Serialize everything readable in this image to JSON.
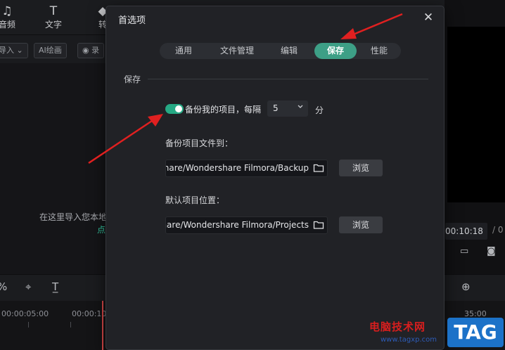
{
  "background": {
    "toolbar": [
      {
        "icon": "music-note-icon",
        "label": "音频"
      },
      {
        "icon": "text-icon",
        "label": "文字"
      },
      {
        "icon": "transition-icon",
        "label": "转"
      }
    ],
    "subbar": {
      "import_label": "导入",
      "ai_label": "AI绘画",
      "record_label": "录"
    },
    "media_hint": "在这里导入您本地",
    "media_link": "点",
    "timecode": "00:10:18",
    "timecode_sep": "/ 0",
    "ruler": [
      "00:00:05:00",
      "00:00:10"
    ],
    "ruler_right": "35:00"
  },
  "dialog": {
    "title": "首选项",
    "tabs": [
      {
        "label": "通用",
        "active": false
      },
      {
        "label": "文件管理",
        "active": false
      },
      {
        "label": "编辑",
        "active": false
      },
      {
        "label": "保存",
        "active": true
      },
      {
        "label": "性能",
        "active": false
      }
    ],
    "section_title": "保存",
    "backup_toggle": {
      "on": true,
      "label": "备份我的项目，每隔"
    },
    "interval": {
      "value": "5",
      "unit": "分"
    },
    "backup_path": {
      "label": "备份项目文件到：",
      "value": "C:/Users/Administrator/Documents/Wondershare/Wondershare Filmora/Backup",
      "browse": "浏览"
    },
    "project_path": {
      "label": "默认项目位置：",
      "value": "C:/Users/Administrator/Documents/Wondershare/Wondershare Filmora/Projects",
      "browse": "浏览"
    }
  },
  "colors": {
    "accent": "#3d9f86",
    "toggle_on": "#26a984",
    "dialog_bg": "#212226",
    "annotation": "#e02020"
  },
  "watermark": {
    "site": "电脑技术网",
    "url": "www.tagxp.com",
    "badge": "TAG"
  }
}
